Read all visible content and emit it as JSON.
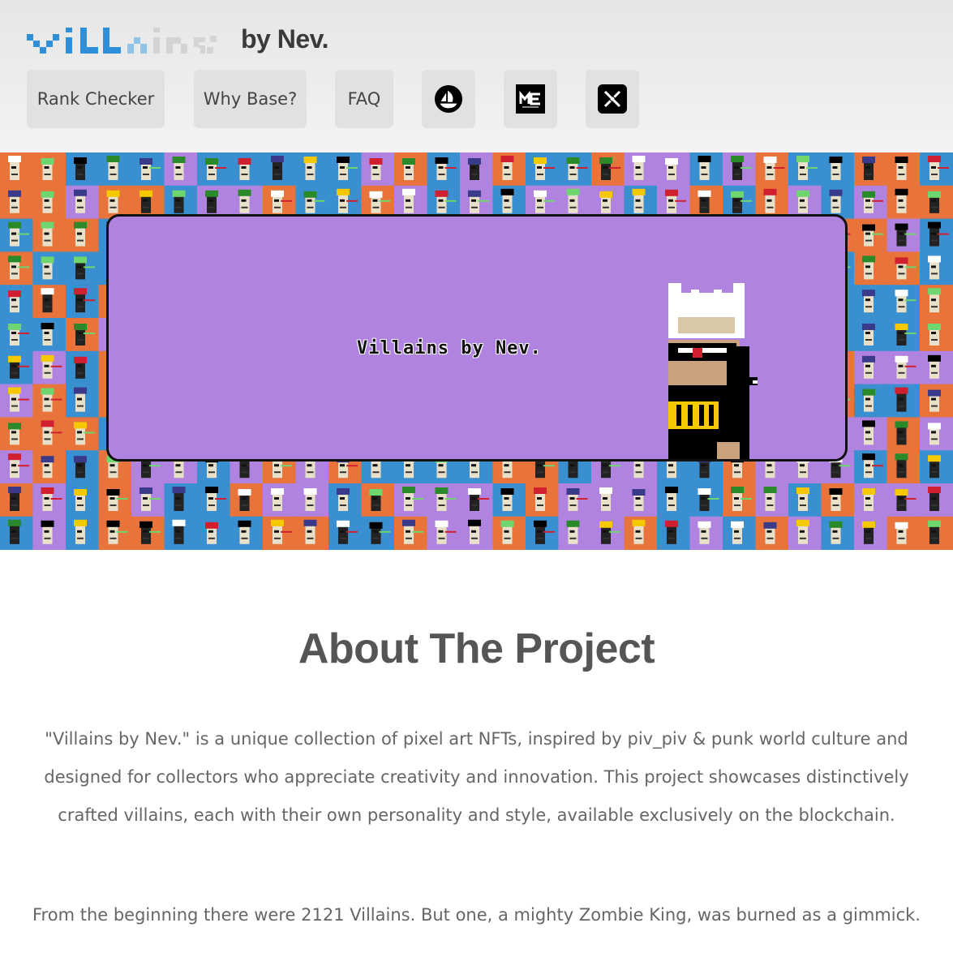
{
  "header": {
    "logo_text": "villains",
    "byline": "by Nev.",
    "nav": [
      {
        "label": "Rank Checker"
      },
      {
        "label": "Why Base?"
      },
      {
        "label": "FAQ"
      }
    ],
    "icons": [
      "opensea-icon",
      "magic-eden-icon",
      "x-icon"
    ]
  },
  "hero": {
    "title": "Villains by Nev."
  },
  "about": {
    "title": "About The Project",
    "paragraph1": "\"Villains by Nev.\" is a unique collection of pixel art NFTs, inspired by piv_piv & punk world culture and designed for collectors who appreciate creativity and innovation. This project showcases distinctively crafted villains, each with their own personality and style, available exclusively on the blockchain.",
    "paragraph2": "From the beginning there were 2121 Villains. But one, a mighty Zombie King, was burned as a gimmick."
  },
  "colors": {
    "tile_blue": "#3a8fd0",
    "tile_orange": "#e8743b",
    "tile_purple": "#b183e0",
    "hero_bg": "#b183e0",
    "logo_blue": "#2f8fd8"
  }
}
